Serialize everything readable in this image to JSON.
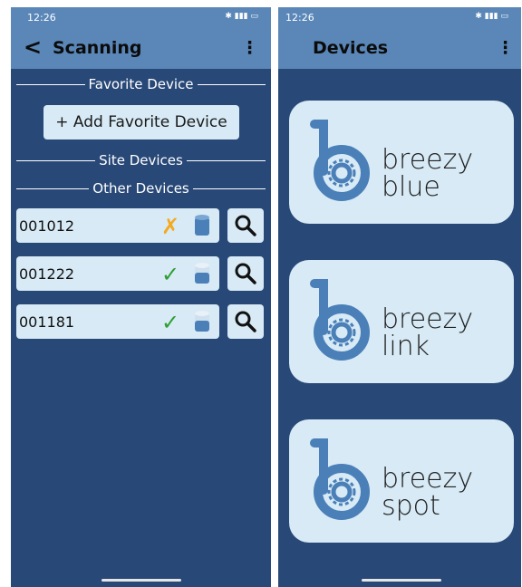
{
  "left": {
    "status": {
      "time": "12:26"
    },
    "appbar": {
      "title": "Scanning"
    },
    "sections": {
      "favorite": "Favorite Device",
      "site": "Site Devices",
      "other": "Other Devices"
    },
    "add_button": "+ Add Favorite Device",
    "devices": [
      {
        "id": "001012",
        "status": "✗",
        "state": "error"
      },
      {
        "id": "001222",
        "status": "✓",
        "state": "ok"
      },
      {
        "id": "001181",
        "status": "✓",
        "state": "ok"
      }
    ]
  },
  "right": {
    "status": {
      "time": "12:26"
    },
    "appbar": {
      "title": "Devices"
    },
    "products": [
      {
        "word1": "breezy",
        "word2": "blue"
      },
      {
        "word1": "breezy",
        "word2": "link"
      },
      {
        "word1": "breezy",
        "word2": "spot"
      }
    ]
  },
  "colors": {
    "background": "#284877",
    "appbar": "#5a87b8",
    "button": "#d7eaf5",
    "ok": "#2f9e34",
    "error": "#f5a91c",
    "logo": "#4a7fb8"
  }
}
